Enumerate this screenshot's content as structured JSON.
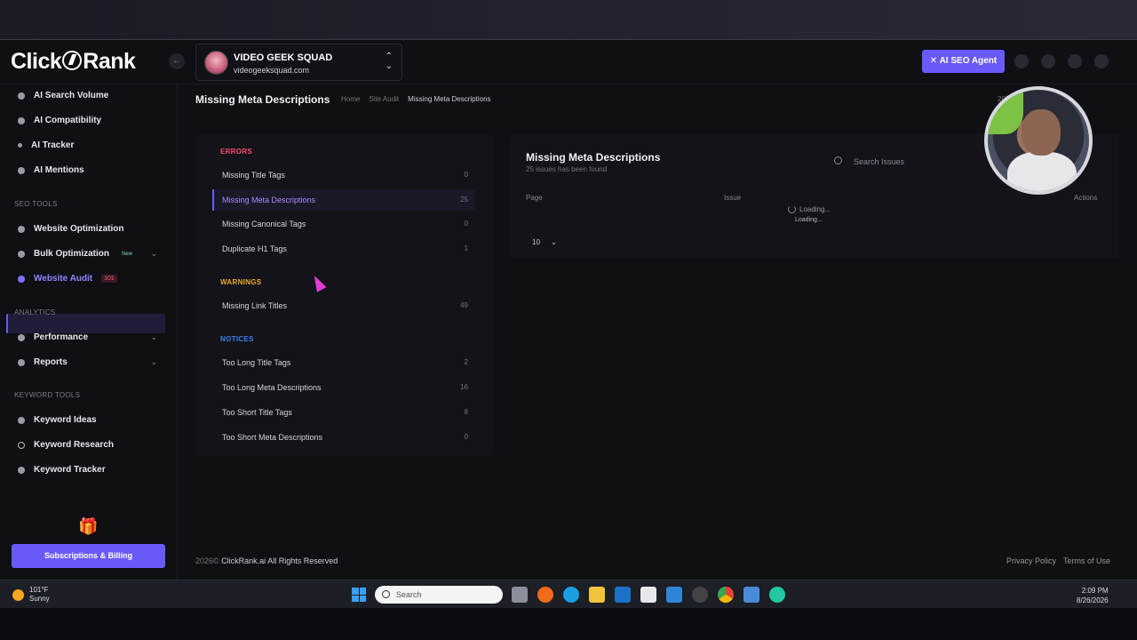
{
  "app": {
    "logo_text": "ClickRank",
    "logo_left": "Click",
    "logo_right": "Rank"
  },
  "workspace": {
    "name": "VIDEO GEEK SQUAD",
    "domain": "videogeeksquad.com"
  },
  "header": {
    "agent_button": "AI SEO Agent",
    "agent_icon": "x-icon"
  },
  "sidebar": {
    "items_top": [
      {
        "label": "AI Search Volume",
        "icon": "search-icon"
      },
      {
        "label": "AI Compatibility",
        "icon": "gear-icon"
      },
      {
        "label": "AI Tracker",
        "icon": "dot-icon"
      },
      {
        "label": "AI Mentions",
        "icon": "mention-icon"
      }
    ],
    "section_seo": "SEO TOOLS",
    "seo_items": [
      {
        "label": "Website Optimization",
        "icon": "rocket-icon"
      },
      {
        "label": "Bulk Optimization",
        "icon": "gear-icon",
        "badge": "New"
      },
      {
        "label": "Website Audit",
        "icon": "audit-icon",
        "badge": "101"
      }
    ],
    "section_analytics": "ANALYTICS",
    "analytics_items": [
      {
        "label": "Performance",
        "icon": "chart-icon"
      },
      {
        "label": "Reports",
        "icon": "flag-icon"
      }
    ],
    "section_keyword": "KEYWORD TOOLS",
    "keyword_items": [
      {
        "label": "Keyword Ideas",
        "icon": "bulb-icon"
      },
      {
        "label": "Keyword Research",
        "icon": "circle-icon"
      },
      {
        "label": "Keyword Tracker",
        "icon": "target-icon"
      }
    ],
    "billing_button": "Subscriptions & Billing"
  },
  "page": {
    "title": "Missing Meta Descriptions",
    "breadcrumb": [
      "Home",
      "Site Audit",
      "Missing Meta Descriptions"
    ],
    "date_hint": "2026"
  },
  "issues": {
    "errors_label": "ERRORS",
    "errors": [
      {
        "label": "Missing Title Tags",
        "count": "0"
      },
      {
        "label": "Missing Meta Descriptions",
        "count": "25"
      },
      {
        "label": "Missing Canonical Tags",
        "count": "0"
      },
      {
        "label": "Duplicate H1 Tags",
        "count": "1"
      }
    ],
    "warnings_label": "WARNINGS",
    "warnings": [
      {
        "label": "Missing Link Titles",
        "count": "49"
      }
    ],
    "notices_label": "NOTICES",
    "notices": [
      {
        "label": "Too Long Title Tags",
        "count": "2"
      },
      {
        "label": "Too Long Meta Descriptions",
        "count": "16"
      },
      {
        "label": "Too Short Title Tags",
        "count": "8"
      },
      {
        "label": "Too Short Meta Descriptions",
        "count": "0"
      }
    ]
  },
  "table": {
    "title": "Missing Meta Descriptions",
    "subtitle": "25 issues has been found",
    "search_placeholder": "Search Issues",
    "columns": [
      "Page",
      "Issue",
      "Actions"
    ],
    "loading_text": "Loading...",
    "ghost_text": "Loading...",
    "page_size": "10"
  },
  "footer": {
    "year": "2026©",
    "copyright": "ClickRank.ai All Rights Reserved",
    "links": [
      "Privacy Policy",
      "Terms of Use"
    ]
  },
  "taskbar": {
    "temperature": "101°F",
    "condition": "Sunny",
    "search_label": "Search",
    "time": "2:09 PM",
    "date": "8/26/2026"
  },
  "colors": {
    "accent": "#6a5af9",
    "errors": "#ff4d6d",
    "warnings": "#f0a830",
    "notices": "#3b82f6",
    "background": "#0f0f14"
  }
}
